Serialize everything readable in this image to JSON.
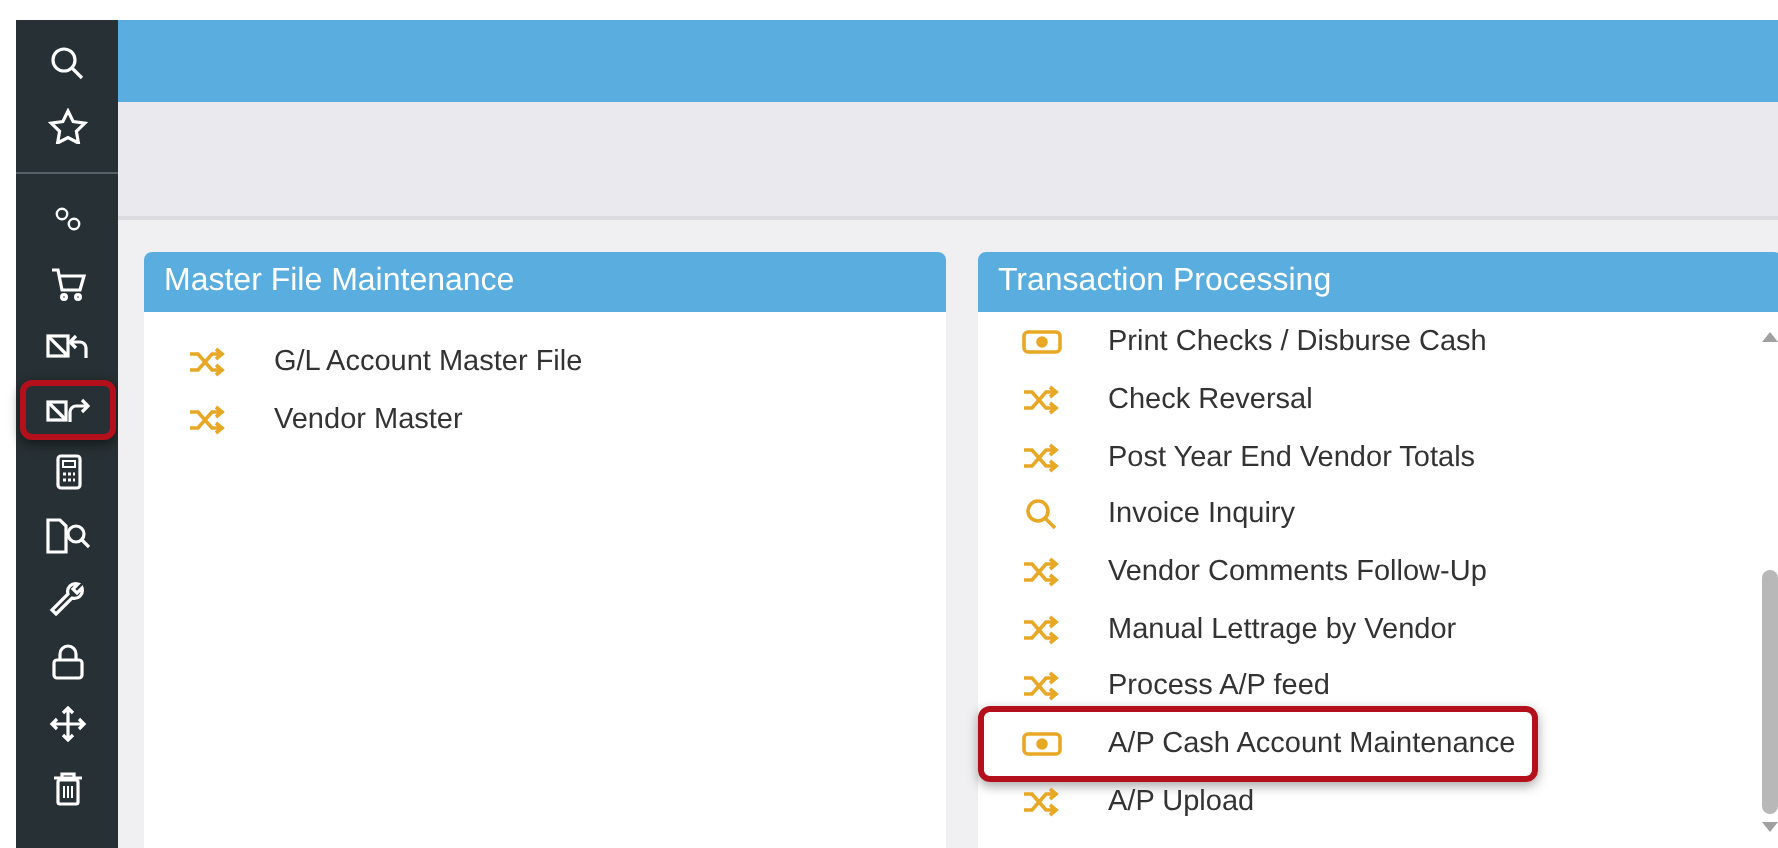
{
  "sidebar": {
    "groups": [
      {
        "items": [
          {
            "kind": "search",
            "highlighted": false
          },
          {
            "kind": "star",
            "highlighted": false
          }
        ]
      },
      {
        "items": [
          {
            "kind": "gears",
            "highlighted": false
          },
          {
            "kind": "cart",
            "highlighted": false
          },
          {
            "kind": "doc-back",
            "highlighted": false
          },
          {
            "kind": "doc-forward",
            "highlighted": true
          },
          {
            "kind": "calculator",
            "highlighted": false
          },
          {
            "kind": "doc-search",
            "highlighted": false
          },
          {
            "kind": "wrench",
            "highlighted": false
          },
          {
            "kind": "lock",
            "highlighted": false
          },
          {
            "kind": "move",
            "highlighted": false
          },
          {
            "kind": "trash",
            "highlighted": false
          }
        ]
      }
    ]
  },
  "panels": [
    {
      "title": "Master File Maintenance",
      "scrollbar": false,
      "items": [
        {
          "kind": "program",
          "label": "G/L Account Master File",
          "highlighted": false
        },
        {
          "kind": "program",
          "label": "Vendor Master",
          "highlighted": false
        }
      ]
    },
    {
      "title": "Transaction Processing",
      "scrollbar": true,
      "items": [
        {
          "kind": "cash",
          "label": "Print Checks / Disburse Cash",
          "highlighted": false
        },
        {
          "kind": "program",
          "label": "Check Reversal",
          "highlighted": false
        },
        {
          "kind": "program",
          "label": "Post Year End Vendor Totals",
          "highlighted": false
        },
        {
          "kind": "inquiry",
          "label": "Invoice Inquiry",
          "highlighted": false
        },
        {
          "kind": "program",
          "label": "Vendor Comments Follow-Up",
          "highlighted": false
        },
        {
          "kind": "program",
          "label": "Manual Lettrage by Vendor",
          "highlighted": false
        },
        {
          "kind": "program",
          "label": "Process A/P feed",
          "highlighted": false
        },
        {
          "kind": "cash",
          "label": "A/P Cash Account Maintenance",
          "highlighted": true
        },
        {
          "kind": "program",
          "label": "A/P Upload",
          "highlighted": false
        }
      ]
    }
  ]
}
